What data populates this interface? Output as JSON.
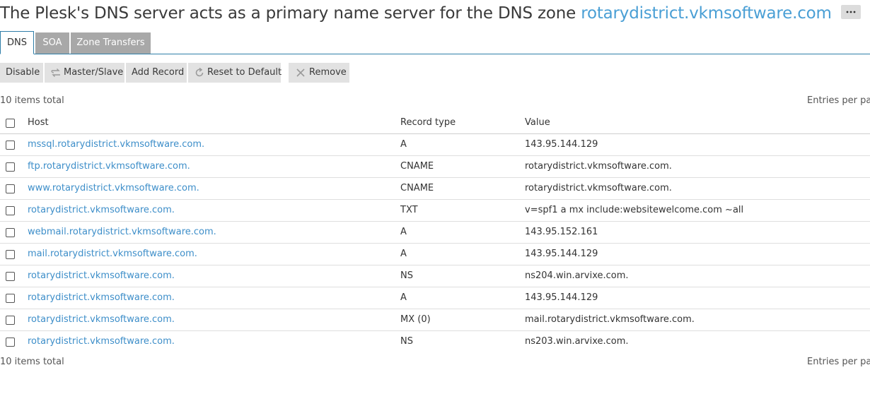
{
  "header": {
    "prefix": "The Plesk's DNS server acts as a primary name server for the DNS zone",
    "zone": "rotarydistrict.vkmsoftware.com"
  },
  "tabs": [
    {
      "label": "DNS",
      "active": true
    },
    {
      "label": "SOA",
      "active": false
    },
    {
      "label": "Zone Transfers",
      "active": false
    }
  ],
  "toolbar": {
    "disable": "Disable",
    "master_slave": "Master/Slave",
    "add_record": "Add Record",
    "reset": "Reset to Default",
    "remove": "Remove"
  },
  "summary": {
    "items_total": "10 items total",
    "entries_per_page": "Entries per page"
  },
  "table": {
    "columns": {
      "host": "Host",
      "type": "Record type",
      "value": "Value"
    },
    "rows": [
      {
        "host": "mssql.rotarydistrict.vkmsoftware.com.",
        "type": "A",
        "value": "143.95.144.129"
      },
      {
        "host": "ftp.rotarydistrict.vkmsoftware.com.",
        "type": "CNAME",
        "value": "rotarydistrict.vkmsoftware.com."
      },
      {
        "host": "www.rotarydistrict.vkmsoftware.com.",
        "type": "CNAME",
        "value": "rotarydistrict.vkmsoftware.com."
      },
      {
        "host": "rotarydistrict.vkmsoftware.com.",
        "type": "TXT",
        "value": "v=spf1 a mx include:websitewelcome.com ~all"
      },
      {
        "host": "webmail.rotarydistrict.vkmsoftware.com.",
        "type": "A",
        "value": "143.95.152.161"
      },
      {
        "host": "mail.rotarydistrict.vkmsoftware.com.",
        "type": "A",
        "value": "143.95.144.129"
      },
      {
        "host": "rotarydistrict.vkmsoftware.com.",
        "type": "NS",
        "value": "ns204.win.arvixe.com."
      },
      {
        "host": "rotarydistrict.vkmsoftware.com.",
        "type": "A",
        "value": "143.95.144.129"
      },
      {
        "host": "rotarydistrict.vkmsoftware.com.",
        "type": "MX (0)",
        "value": "mail.rotarydistrict.vkmsoftware.com."
      },
      {
        "host": "rotarydistrict.vkmsoftware.com.",
        "type": "NS",
        "value": "ns203.win.arvixe.com."
      }
    ]
  },
  "colors": {
    "link": "#3d8ec9",
    "tab_border": "#2f7ea8",
    "tab_inactive": "#a8a8a8",
    "button_bg": "#e2e2e2"
  }
}
